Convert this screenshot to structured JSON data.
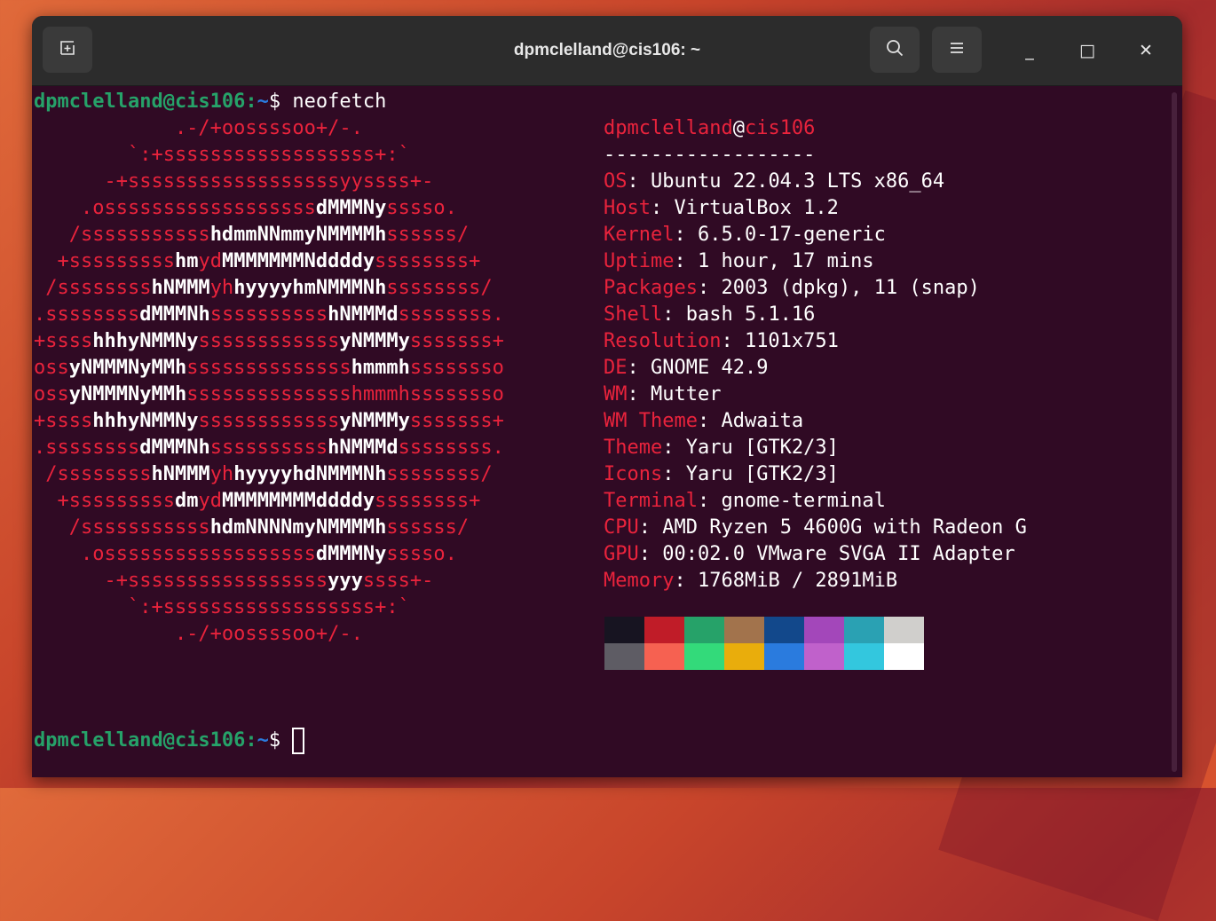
{
  "window": {
    "title": "dpmclelland@cis106: ~"
  },
  "titlebar": {
    "new_tab_icon": "new-tab-icon",
    "search_icon": "search-icon",
    "menu_icon": "hamburger-menu-icon",
    "minimize_glyph": "_",
    "maximize_glyph": "□",
    "close_glyph": "✕"
  },
  "prompt": {
    "user_host": "dpmclelland@cis106",
    "sep": ":",
    "path": "~",
    "dollar": "$ "
  },
  "command": "neofetch",
  "header": {
    "user": "dpmclelland",
    "at": "@",
    "host": "cis106",
    "rule": "------------------"
  },
  "info": [
    {
      "key": "OS",
      "value": ": Ubuntu 22.04.3 LTS x86_64"
    },
    {
      "key": "Host",
      "value": ": VirtualBox 1.2"
    },
    {
      "key": "Kernel",
      "value": ": 6.5.0-17-generic"
    },
    {
      "key": "Uptime",
      "value": ": 1 hour, 17 mins"
    },
    {
      "key": "Packages",
      "value": ": 2003 (dpkg), 11 (snap)"
    },
    {
      "key": "Shell",
      "value": ": bash 5.1.16"
    },
    {
      "key": "Resolution",
      "value": ": 1101x751"
    },
    {
      "key": "DE",
      "value": ": GNOME 42.9"
    },
    {
      "key": "WM",
      "value": ": Mutter"
    },
    {
      "key": "WM Theme",
      "value": ": Adwaita"
    },
    {
      "key": "Theme",
      "value": ": Yaru [GTK2/3]"
    },
    {
      "key": "Icons",
      "value": ": Yaru [GTK2/3]"
    },
    {
      "key": "Terminal",
      "value": ": gnome-terminal"
    },
    {
      "key": "CPU",
      "value": ": AMD Ryzen 5 4600G with Radeon G"
    },
    {
      "key": "GPU",
      "value": ": 00:02.0 VMware SVGA II Adapter"
    },
    {
      "key": "Memory",
      "value": ": 1768MiB / 2891MiB"
    }
  ],
  "logo": [
    [
      "            .-/+oossssoo+/-."
    ],
    [
      "        `:+ssssssssssssssssss+:`"
    ],
    [
      "      -+ssssssssssssssssssyyssss+-"
    ],
    [
      "    .ossssssssssssssssss",
      "dMMMNy",
      "sssso."
    ],
    [
      "   /sssssssssss",
      "hdmmNNmmyNMMMMh",
      "ssssss/"
    ],
    [
      "  +sssssssss",
      "hm",
      "yd",
      "MMMMMMMNddddy",
      "ssssssss+"
    ],
    [
      " /ssssssss",
      "hNMMM",
      "yh",
      "hyyyyhmNMMMNh",
      "ssssssss/"
    ],
    [
      ".ssssssss",
      "dMMMNh",
      "ssssssssss",
      "hNMMMd",
      "ssssssss."
    ],
    [
      "+ssss",
      "hhhyNMMNy",
      "ssssssssssss",
      "yNMMMy",
      "sssssss+"
    ],
    [
      "oss",
      "yNMMMNyMMh",
      "ssssssssssssss",
      "hmmmh",
      "ssssssso"
    ],
    [
      "oss",
      "yNMMMNyMMh",
      "sssssssssssssshmmmhssssssso"
    ],
    [
      "+ssss",
      "hhhyNMMNy",
      "ssssssssssss",
      "yNMMMy",
      "sssssss+"
    ],
    [
      ".ssssssss",
      "dMMMNh",
      "ssssssssss",
      "hNMMMd",
      "ssssssss."
    ],
    [
      " /ssssssss",
      "hNMMM",
      "yh",
      "hyyyyhdNMMMNh",
      "ssssssss/"
    ],
    [
      "  +sssssssss",
      "dm",
      "yd",
      "MMMMMMMMddddy",
      "ssssssss+"
    ],
    [
      "   /sssssssssss",
      "hdmNNNNmyNMMMMh",
      "ssssss/"
    ],
    [
      "    .ossssssssssssssssss",
      "dMMMNy",
      "sssso."
    ],
    [
      "      -+sssssssssssssssss",
      "yyy",
      "ssss+-"
    ],
    [
      "        `:+ssssssssssssssssss+:`"
    ],
    [
      "            .-/+oossssoo+/-."
    ]
  ],
  "palette": {
    "normal": [
      "#171421",
      "#c01c28",
      "#26a269",
      "#a2734c",
      "#12488b",
      "#a347ba",
      "#2aa1b3",
      "#d0cfcc"
    ],
    "bright": [
      "#5e5c64",
      "#f66151",
      "#33da7a",
      "#e9ad0c",
      "#2a7bde",
      "#c061cb",
      "#33c7de",
      "#ffffff"
    ]
  },
  "colors": {
    "background": "#300a24",
    "accent_red": "#e9233c",
    "prompt_green": "#26a269",
    "prompt_blue": "#2a7bde"
  }
}
